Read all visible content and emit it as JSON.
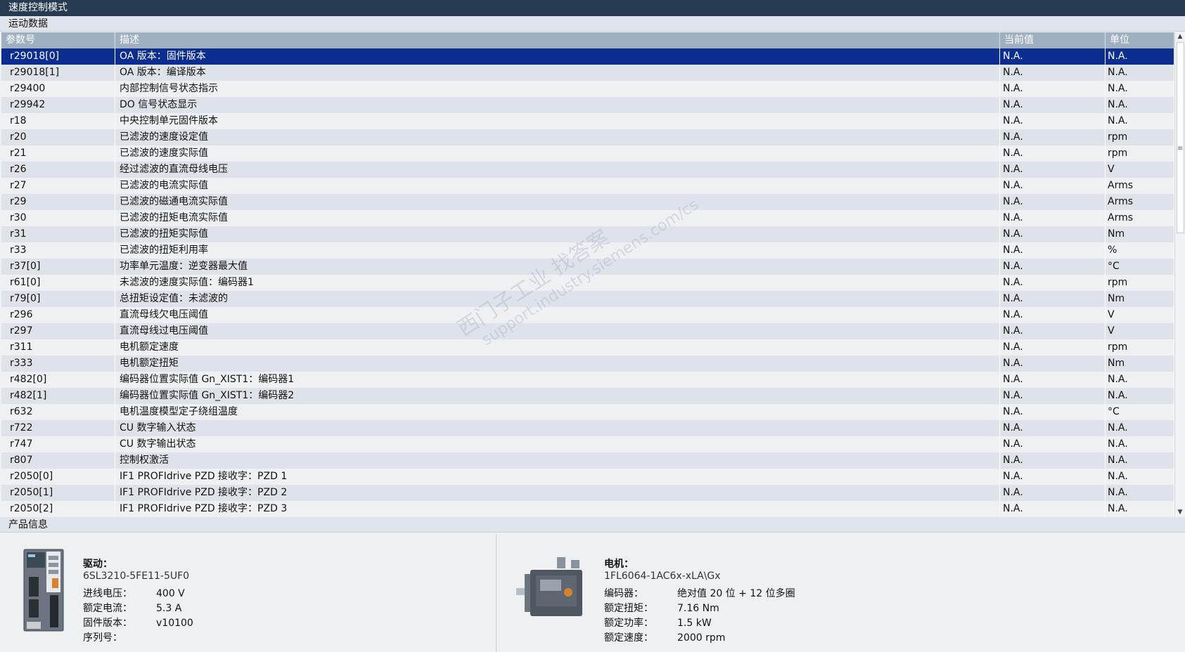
{
  "window": {
    "title": "速度控制模式"
  },
  "motion_section": {
    "label": "运动数据"
  },
  "table": {
    "headers": {
      "param": "参数号",
      "desc": "描述",
      "value": "当前值",
      "unit": "单位"
    },
    "rows": [
      {
        "param": "r29018[0]",
        "desc": "OA 版本：固件版本",
        "value": "N.A.",
        "unit": "N.A."
      },
      {
        "param": "r29018[1]",
        "desc": "OA 版本：编译版本",
        "value": "N.A.",
        "unit": "N.A."
      },
      {
        "param": "r29400",
        "desc": "内部控制信号状态指示",
        "value": "N.A.",
        "unit": "N.A."
      },
      {
        "param": "r29942",
        "desc": "DO 信号状态显示",
        "value": "N.A.",
        "unit": "N.A."
      },
      {
        "param": "r18",
        "desc": "中央控制单元固件版本",
        "value": "N.A.",
        "unit": "N.A."
      },
      {
        "param": "r20",
        "desc": "已滤波的速度设定值",
        "value": "N.A.",
        "unit": "rpm"
      },
      {
        "param": "r21",
        "desc": "已滤波的速度实际值",
        "value": "N.A.",
        "unit": "rpm"
      },
      {
        "param": "r26",
        "desc": "经过滤波的直流母线电压",
        "value": "N.A.",
        "unit": "V"
      },
      {
        "param": "r27",
        "desc": "已滤波的电流实际值",
        "value": "N.A.",
        "unit": "Arms"
      },
      {
        "param": "r29",
        "desc": "已滤波的磁通电流实际值",
        "value": "N.A.",
        "unit": "Arms"
      },
      {
        "param": "r30",
        "desc": "已滤波的扭矩电流实际值",
        "value": "N.A.",
        "unit": "Arms"
      },
      {
        "param": "r31",
        "desc": "已滤波的扭矩实际值",
        "value": "N.A.",
        "unit": "Nm"
      },
      {
        "param": "r33",
        "desc": "已滤波的扭矩利用率",
        "value": "N.A.",
        "unit": "%"
      },
      {
        "param": "r37[0]",
        "desc": "功率单元温度：逆变器最大值",
        "value": "N.A.",
        "unit": "°C"
      },
      {
        "param": "r61[0]",
        "desc": "未滤波的速度实际值：编码器1",
        "value": "N.A.",
        "unit": "rpm"
      },
      {
        "param": "r79[0]",
        "desc": "总扭矩设定值：未滤波的",
        "value": "N.A.",
        "unit": "Nm"
      },
      {
        "param": "r296",
        "desc": "直流母线欠电压阈值",
        "value": "N.A.",
        "unit": "V"
      },
      {
        "param": "r297",
        "desc": "直流母线过电压阈值",
        "value": "N.A.",
        "unit": "V"
      },
      {
        "param": "r311",
        "desc": "电机额定速度",
        "value": "N.A.",
        "unit": "rpm"
      },
      {
        "param": "r333",
        "desc": "电机额定扭矩",
        "value": "N.A.",
        "unit": "Nm"
      },
      {
        "param": "r482[0]",
        "desc": "编码器位置实际值 Gn_XIST1：编码器1",
        "value": "N.A.",
        "unit": "N.A."
      },
      {
        "param": "r482[1]",
        "desc": "编码器位置实际值 Gn_XIST1：编码器2",
        "value": "N.A.",
        "unit": "N.A."
      },
      {
        "param": "r632",
        "desc": "电机温度模型定子绕组温度",
        "value": "N.A.",
        "unit": "°C"
      },
      {
        "param": "r722",
        "desc": "CU 数字输入状态",
        "value": "N.A.",
        "unit": "N.A."
      },
      {
        "param": "r747",
        "desc": "CU 数字输出状态",
        "value": "N.A.",
        "unit": "N.A."
      },
      {
        "param": "r807",
        "desc": "控制权激活",
        "value": "N.A.",
        "unit": "N.A."
      },
      {
        "param": "r2050[0]",
        "desc": "IF1 PROFIdrive PZD 接收字：PZD 1",
        "value": "N.A.",
        "unit": "N.A."
      },
      {
        "param": "r2050[1]",
        "desc": "IF1 PROFIdrive PZD 接收字：PZD 2",
        "value": "N.A.",
        "unit": "N.A."
      },
      {
        "param": "r2050[2]",
        "desc": "IF1 PROFIdrive PZD 接收字：PZD 3",
        "value": "N.A.",
        "unit": "N.A."
      }
    ]
  },
  "watermark": {
    "line1": "西门子工业 找答案",
    "line2": "support.industry.siemens.com/cs"
  },
  "product_section": {
    "label": "产品信息"
  },
  "drive": {
    "heading": "驱动：",
    "model": "6SL3210-5FE11-5UF0",
    "specs": [
      {
        "key": "进线电压：",
        "value": "400 V"
      },
      {
        "key": "额定电流：",
        "value": "5.3 A"
      },
      {
        "key": "固件版本：",
        "value": "v10100"
      },
      {
        "key": "序列号：",
        "value": ""
      }
    ]
  },
  "motor": {
    "heading": "电机：",
    "model": "1FL6064-1AC6x-xLA\\Gx",
    "specs": [
      {
        "key": "编码器：",
        "value": "绝对值 20 位 + 12 位多圈"
      },
      {
        "key": "额定扭矩：",
        "value": "7.16 Nm"
      },
      {
        "key": "额定功率：",
        "value": "1.5 kW"
      },
      {
        "key": "额定速度：",
        "value": "2000 rpm"
      }
    ]
  }
}
